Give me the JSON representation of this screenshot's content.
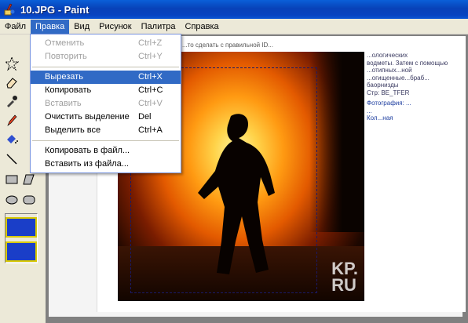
{
  "window": {
    "title": "10.JPG - Paint"
  },
  "menubar": {
    "items": [
      "Файл",
      "Правка",
      "Вид",
      "Рисунок",
      "Палитра",
      "Справка"
    ],
    "active": "Правка"
  },
  "edit_menu": {
    "items": [
      {
        "label": "Отменить",
        "shortcut": "Ctrl+Z",
        "state": "disabled"
      },
      {
        "label": "Повторить",
        "shortcut": "Ctrl+Y",
        "state": "disabled"
      },
      {
        "label": "Вырезать",
        "shortcut": "Ctrl+X",
        "state": "highlighted"
      },
      {
        "label": "Копировать",
        "shortcut": "Ctrl+C",
        "state": "enabled"
      },
      {
        "label": "Вставить",
        "shortcut": "Ctrl+V",
        "state": "disabled"
      },
      {
        "label": "Очистить выделение",
        "shortcut": "Del",
        "state": "enabled"
      },
      {
        "label": "Выделить все",
        "shortcut": "Ctrl+A",
        "state": "enabled"
      },
      {
        "label": "Копировать в файл...",
        "shortcut": "",
        "state": "enabled"
      },
      {
        "label": "Вставить из файла...",
        "shortcut": "",
        "state": "enabled"
      }
    ]
  },
  "image": {
    "watermark_line1": "KP.",
    "watermark_line2": "RU",
    "top_caption": "...то сделать с правильной ID...",
    "side_text": [
      "...ологических",
      "водметы. Затем с помощью",
      "...отипных...ной",
      "...огищенные...браб...",
      "баорнизды",
      "Стр: BE_TFER"
    ],
    "credit": [
      "Фотография: ...",
      "...",
      "Кол...ная"
    ]
  },
  "colors": {
    "titlebar": "#0842b8",
    "menu_highlight": "#316ac5",
    "workspace": "#808080"
  }
}
